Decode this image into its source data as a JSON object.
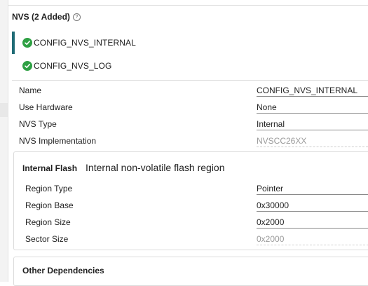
{
  "section": {
    "title": "NVS (2 Added)",
    "help_icon": "help-circle-icon"
  },
  "instances": [
    {
      "label": "CONFIG_NVS_INTERNAL",
      "status_icon": "check-circle-icon",
      "selected": true
    },
    {
      "label": "CONFIG_NVS_LOG",
      "status_icon": "check-circle-icon",
      "selected": false
    }
  ],
  "fields": [
    {
      "name": "Name",
      "value": "CONFIG_NVS_INTERNAL",
      "readonly": false
    },
    {
      "name": "Use Hardware",
      "value": "None",
      "readonly": false
    },
    {
      "name": "NVS Type",
      "value": "Internal",
      "readonly": false
    },
    {
      "name": "NVS Implementation",
      "value": "NVSCC26XX",
      "readonly": true
    }
  ],
  "internal_flash": {
    "title": "Internal Flash",
    "description": "Internal non-volatile flash region",
    "fields": [
      {
        "name": "Region Type",
        "value": "Pointer",
        "readonly": false
      },
      {
        "name": "Region Base",
        "value": "0x30000",
        "readonly": false
      },
      {
        "name": "Region Size",
        "value": "0x2000",
        "readonly": false
      },
      {
        "name": "Sector Size",
        "value": "0x2000",
        "readonly": true
      }
    ]
  },
  "other_dependencies": {
    "title": "Other Dependencies"
  },
  "colors": {
    "check_green": "#2ea043",
    "selection_bar": "#1f6b75",
    "divider": "#dcdcdc"
  }
}
